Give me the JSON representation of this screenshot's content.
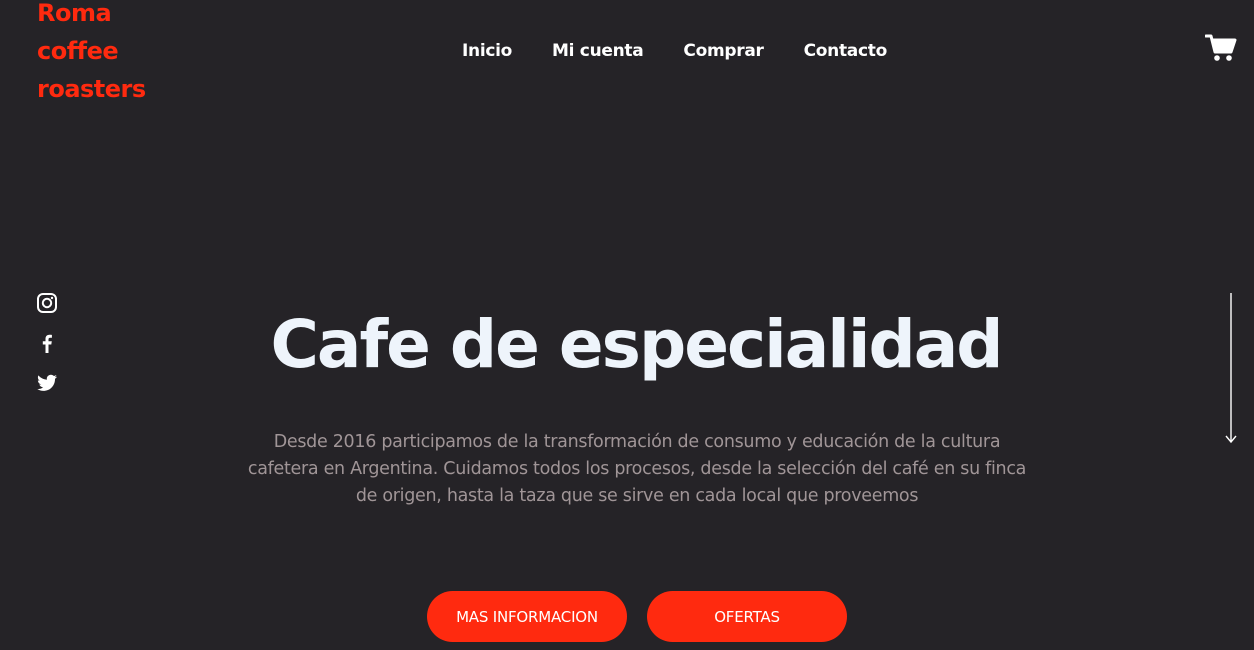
{
  "brand": {
    "logo_lines": [
      "Roma",
      "coffee",
      "roasters"
    ],
    "color": "#ff2a0f"
  },
  "nav": {
    "items": [
      {
        "label": "Inicio"
      },
      {
        "label": "Mi cuenta"
      },
      {
        "label": "Comprar"
      },
      {
        "label": "Contacto"
      }
    ]
  },
  "header": {
    "cart_icon": "shopping-cart-icon"
  },
  "social": {
    "icons": [
      "instagram-icon",
      "facebook-icon",
      "twitter-icon"
    ]
  },
  "hero": {
    "title": "Cafe de especialidad",
    "description": "Desde 2016 participamos de la transformación de consumo y educación de la cultura cafetera en Argentina. Cuidamos todos los procesos, desde la selección del café en su finca de origen, hasta la taza que se sirve en cada local que proveemos",
    "buttons": {
      "primary": "MAS INFORMACION",
      "secondary": "OFERTAS"
    },
    "scroll_icon": "scroll-down-arrow-icon"
  },
  "colors": {
    "background": "#252327",
    "accent": "#ff2a0f",
    "title": "#eef4fb",
    "body_text": "#a09597"
  }
}
